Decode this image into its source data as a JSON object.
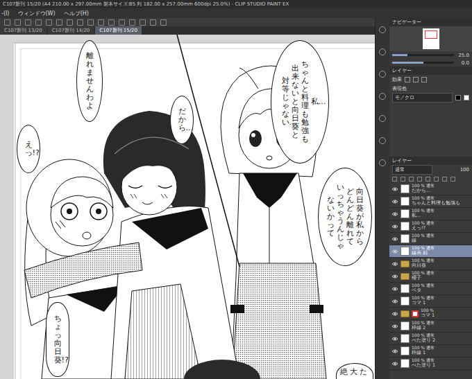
{
  "window": {
    "title": "C107新刊 15/20 (A4 210.00 x 297.00mm 製本サイズ:B5 判 182.00 x 257.00mm 600dpi 25.0%) - CLIP STUDIO PAINT EX"
  },
  "menu": [
    "-(I)",
    "ウィンドウ(W)",
    "ヘルプ(H)"
  ],
  "tabs": [
    {
      "label": "C107新刊 13/20",
      "selected": false
    },
    {
      "label": "C107新刊 14/20",
      "selected": false
    },
    {
      "label": "C107新刊 15/20",
      "selected": true
    }
  ],
  "page": {
    "bubbles": [
      {
        "kind": "vertical",
        "columns": [
          "離れませんわよ"
        ]
      },
      {
        "kind": "vertical",
        "columns": [
          "だから…"
        ]
      },
      {
        "kind": "vertical",
        "columns": [
          "えっ!?"
        ]
      },
      {
        "kind": "vertical",
        "columns": [
          "私…",
          "ちゃんと料理も勉強も",
          "出来ないと向日葵と",
          "対等じゃない…"
        ]
      },
      {
        "kind": "vertical",
        "columns": [
          "向日葵が私から",
          "どんどん離れて",
          "いっちゃうんじゃ",
          "ないかって"
        ]
      },
      {
        "kind": "vertical",
        "columns": [
          "ちょっ向日葵!?"
        ]
      },
      {
        "kind": "horizontal",
        "columns": [
          "絶大た"
        ]
      }
    ]
  },
  "navigator": {
    "title": "ナビゲーター",
    "zoom": "25.0",
    "zoom_level": 0.25,
    "rotation": "0.0",
    "rotation_level": 0.5
  },
  "layer_property": {
    "tab": "レイヤー",
    "effect_label": "効果",
    "color_label": "表現色",
    "color_mode": "モノクロ"
  },
  "layers": {
    "title": "レイヤー",
    "blend_mode": "通常",
    "opacity": "100",
    "items": [
      {
        "info": "100 % 通常",
        "name": "だから…",
        "kind": "layer",
        "selected": false,
        "visible": true
      },
      {
        "info": "100 % 通常",
        "name": "ちゃんと料理も勉強も",
        "kind": "layer",
        "selected": false,
        "visible": true
      },
      {
        "info": "100 % 通常",
        "name": "私…",
        "kind": "layer",
        "selected": false,
        "visible": true
      },
      {
        "info": "100 % 通常",
        "name": "えっ!?",
        "kind": "layer",
        "selected": false,
        "visible": true
      },
      {
        "info": "100 % 通常",
        "name": "線",
        "kind": "layer",
        "selected": false,
        "visible": true
      },
      {
        "info": "100 % 通常",
        "name": "線画 顔",
        "kind": "layer",
        "selected": true,
        "visible": true
      },
      {
        "info": "100 % 通常",
        "name": "向日葵",
        "kind": "folder",
        "selected": false,
        "visible": true
      },
      {
        "info": "100 % 通常",
        "name": "櫻子",
        "kind": "folder",
        "selected": false,
        "visible": true
      },
      {
        "info": "100 % 通常",
        "name": "ベタ",
        "kind": "layer",
        "selected": false,
        "visible": true
      },
      {
        "info": "100 % 通常",
        "name": "コマ 1",
        "kind": "layer",
        "selected": false,
        "visible": true
      },
      {
        "info": "100 %",
        "name": "コマ 1",
        "kind": "frame-folder",
        "selected": false,
        "visible": true
      },
      {
        "info": "100 % 通常",
        "name": "枠線 2",
        "kind": "layer",
        "selected": false,
        "visible": true
      },
      {
        "info": "100 % 通常",
        "name": "べた塗り 2",
        "kind": "layer",
        "selected": false,
        "visible": true
      },
      {
        "info": "100 % 通常",
        "name": "枠線 1",
        "kind": "layer",
        "selected": false,
        "visible": true
      },
      {
        "info": "100 % 通常",
        "name": "べた塗り 1",
        "kind": "layer",
        "selected": false,
        "visible": true
      }
    ]
  }
}
